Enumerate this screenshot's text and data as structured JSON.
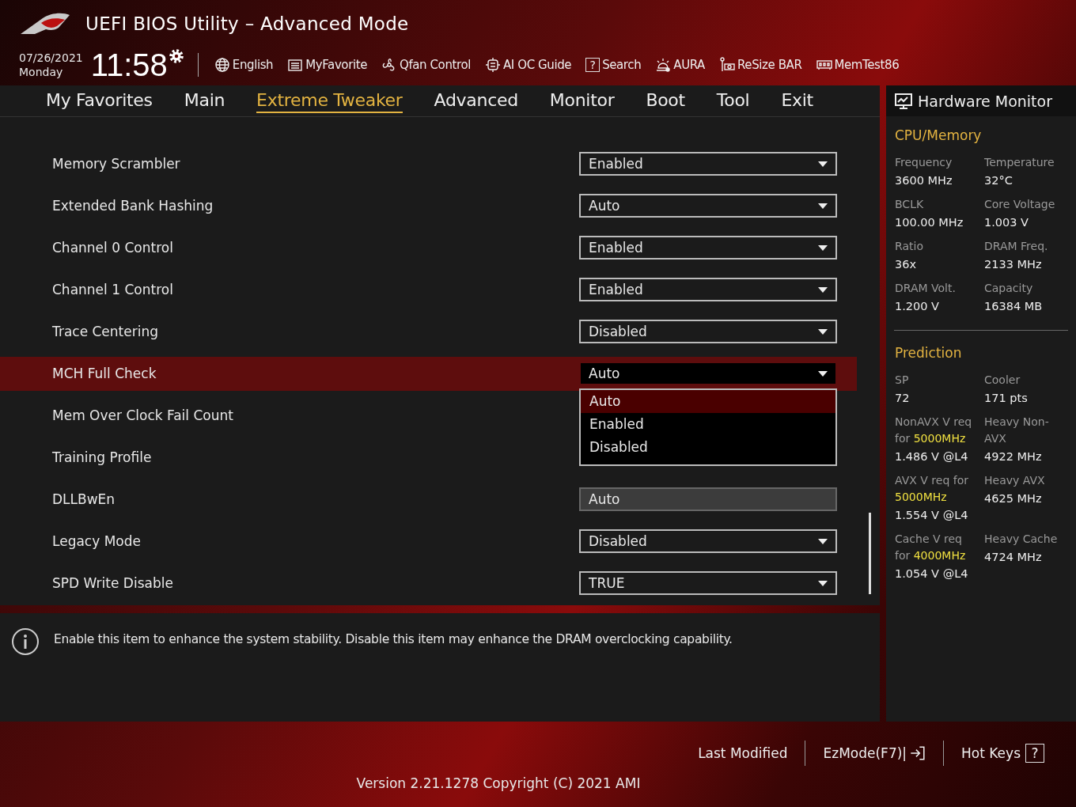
{
  "window": {
    "title": "UEFI BIOS Utility – Advanced Mode"
  },
  "clock": {
    "date": "07/26/2021",
    "day": "Monday",
    "time": "11:58"
  },
  "toolbar": [
    {
      "label": "English"
    },
    {
      "label": "MyFavorite"
    },
    {
      "label": "Qfan Control"
    },
    {
      "label": "AI OC Guide"
    },
    {
      "label": "Search",
      "glyph": "?"
    },
    {
      "label": "AURA"
    },
    {
      "label": "ReSize BAR"
    },
    {
      "label": "MemTest86"
    }
  ],
  "tabs": [
    {
      "label": "My Favorites",
      "selected": false
    },
    {
      "label": "Main",
      "selected": false
    },
    {
      "label": "Extreme Tweaker",
      "selected": true
    },
    {
      "label": "Advanced",
      "selected": false
    },
    {
      "label": "Monitor",
      "selected": false
    },
    {
      "label": "Boot",
      "selected": false
    },
    {
      "label": "Tool",
      "selected": false
    },
    {
      "label": "Exit",
      "selected": false
    }
  ],
  "settings": [
    {
      "label": "Memory Scrambler",
      "kind": "dropdown",
      "value": "Enabled",
      "selected": false
    },
    {
      "label": "Extended Bank Hashing",
      "kind": "dropdown",
      "value": "Auto",
      "selected": false
    },
    {
      "label": "Channel 0 Control",
      "kind": "dropdown",
      "value": "Enabled",
      "selected": false
    },
    {
      "label": "Channel 1 Control",
      "kind": "dropdown",
      "value": "Enabled",
      "selected": false
    },
    {
      "label": "Trace Centering",
      "kind": "dropdown",
      "value": "Disabled",
      "selected": false
    },
    {
      "label": "MCH Full Check",
      "kind": "dropdown",
      "value": "Auto",
      "selected": true,
      "open": true,
      "options": [
        {
          "label": "Auto",
          "selected": true
        },
        {
          "label": "Enabled",
          "selected": false
        },
        {
          "label": "Disabled",
          "selected": false
        }
      ]
    },
    {
      "label": "Mem Over Clock Fail Count",
      "kind": "hidden",
      "selected": false
    },
    {
      "label": "Training Profile",
      "kind": "hidden",
      "selected": false
    },
    {
      "label": "DLLBwEn",
      "kind": "display",
      "value": "Auto",
      "selected": false
    },
    {
      "label": "Legacy Mode",
      "kind": "dropdown",
      "value": "Disabled",
      "selected": false
    },
    {
      "label": "SPD Write Disable",
      "kind": "dropdown",
      "value": "TRUE",
      "selected": false
    }
  ],
  "help": {
    "text": "Enable this item to enhance the system stability. Disable this item may enhance the DRAM overclocking capability."
  },
  "hardware_monitor": {
    "title": "Hardware Monitor",
    "sections": [
      {
        "title": "CPU/Memory",
        "items": [
          {
            "label": "Frequency",
            "value": "3600 MHz"
          },
          {
            "label": "Temperature",
            "value": "32°C"
          },
          {
            "label": "BCLK",
            "value": "100.00 MHz"
          },
          {
            "label": "Core Voltage",
            "value": "1.003 V"
          },
          {
            "label": "Ratio",
            "value": "36x"
          },
          {
            "label": "DRAM Freq.",
            "value": "2133 MHz"
          },
          {
            "label": "DRAM Volt.",
            "value": "1.200 V"
          },
          {
            "label": "Capacity",
            "value": "16384 MB"
          }
        ]
      },
      {
        "title": "Prediction",
        "items": [
          {
            "label": "SP",
            "value": "72"
          },
          {
            "label": "Cooler",
            "value": "171 pts"
          },
          {
            "label": "NonAVX V req for **5000MHz**",
            "value": "1.486 V @L4"
          },
          {
            "label": "Heavy Non-AVX",
            "value": "4922 MHz"
          },
          {
            "label": "AVX V req for **5000MHz**",
            "value": "1.554 V @L4"
          },
          {
            "label": "Heavy AVX",
            "value": "4625 MHz"
          },
          {
            "label": "Cache V req for **4000MHz**",
            "value": "1.054 V @L4"
          },
          {
            "label": "Heavy Cache",
            "value": "4724 MHz"
          }
        ]
      }
    ]
  },
  "footer": {
    "actions": [
      {
        "label": "Last Modified"
      },
      {
        "label": "EzMode(F7)|"
      },
      {
        "label": "Hot Keys",
        "glyph": "?"
      }
    ],
    "version": "Version 2.21.1278 Copyright (C) 2021 AMI"
  }
}
